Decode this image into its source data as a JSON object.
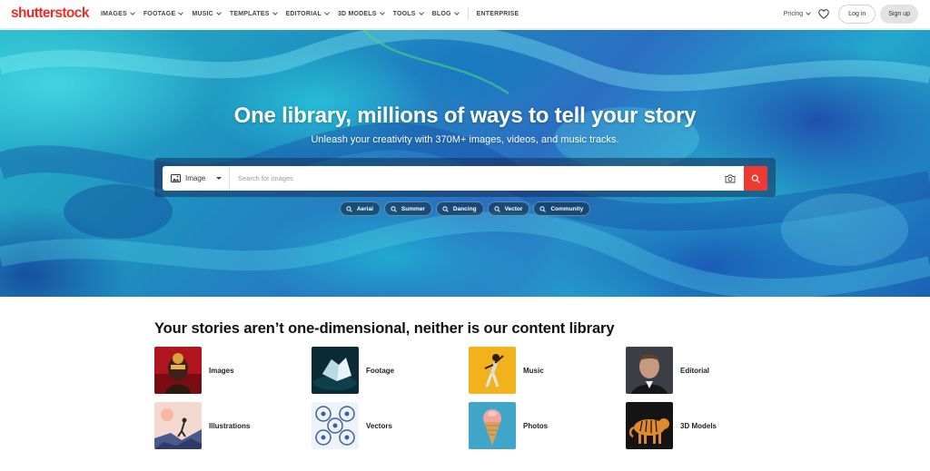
{
  "header": {
    "logo_main": "shutterst",
    "logo_o": "o",
    "logo_end": "ck",
    "nav": [
      {
        "label": "IMAGES",
        "dropdown": true
      },
      {
        "label": "FOOTAGE",
        "dropdown": true
      },
      {
        "label": "MUSIC",
        "dropdown": true
      },
      {
        "label": "TEMPLATES",
        "dropdown": true
      },
      {
        "label": "EDITORIAL",
        "dropdown": true
      },
      {
        "label": "3D MODELS",
        "dropdown": true
      },
      {
        "label": "TOOLS",
        "dropdown": true
      },
      {
        "label": "BLOG",
        "dropdown": true
      },
      {
        "label": "ENTERPRISE",
        "dropdown": false
      }
    ],
    "pricing_label": "Pricing",
    "login_label": "Log in",
    "signup_label": "Sign up"
  },
  "hero": {
    "title": "One library, millions of ways to tell your story",
    "subtitle": "Unleash your creativity with 370M+ images, videos, and music tracks.",
    "search": {
      "type_label": "Image",
      "placeholder": "Search for images"
    },
    "chips": [
      "Aerial",
      "Summer",
      "Dancing",
      "Vector",
      "Community"
    ]
  },
  "section": {
    "title": "Your stories aren’t one-dimensional, neither is our content library",
    "categories": [
      {
        "label": "Images",
        "icon": "portrait-thumbnail"
      },
      {
        "label": "Footage",
        "icon": "iceberg-thumbnail"
      },
      {
        "label": "Music",
        "icon": "dancer-thumbnail"
      },
      {
        "label": "Editorial",
        "icon": "celebrity-thumbnail"
      },
      {
        "label": "Illustrations",
        "icon": "hiker-illustration-thumbnail"
      },
      {
        "label": "Vectors",
        "icon": "pattern-thumbnail"
      },
      {
        "label": "Photos",
        "icon": "ice-cream-thumbnail"
      },
      {
        "label": "3D Models",
        "icon": "tiger-thumbnail"
      }
    ]
  },
  "colors": {
    "brand_red": "#ee2b24",
    "search_button": "#ee3a30"
  }
}
